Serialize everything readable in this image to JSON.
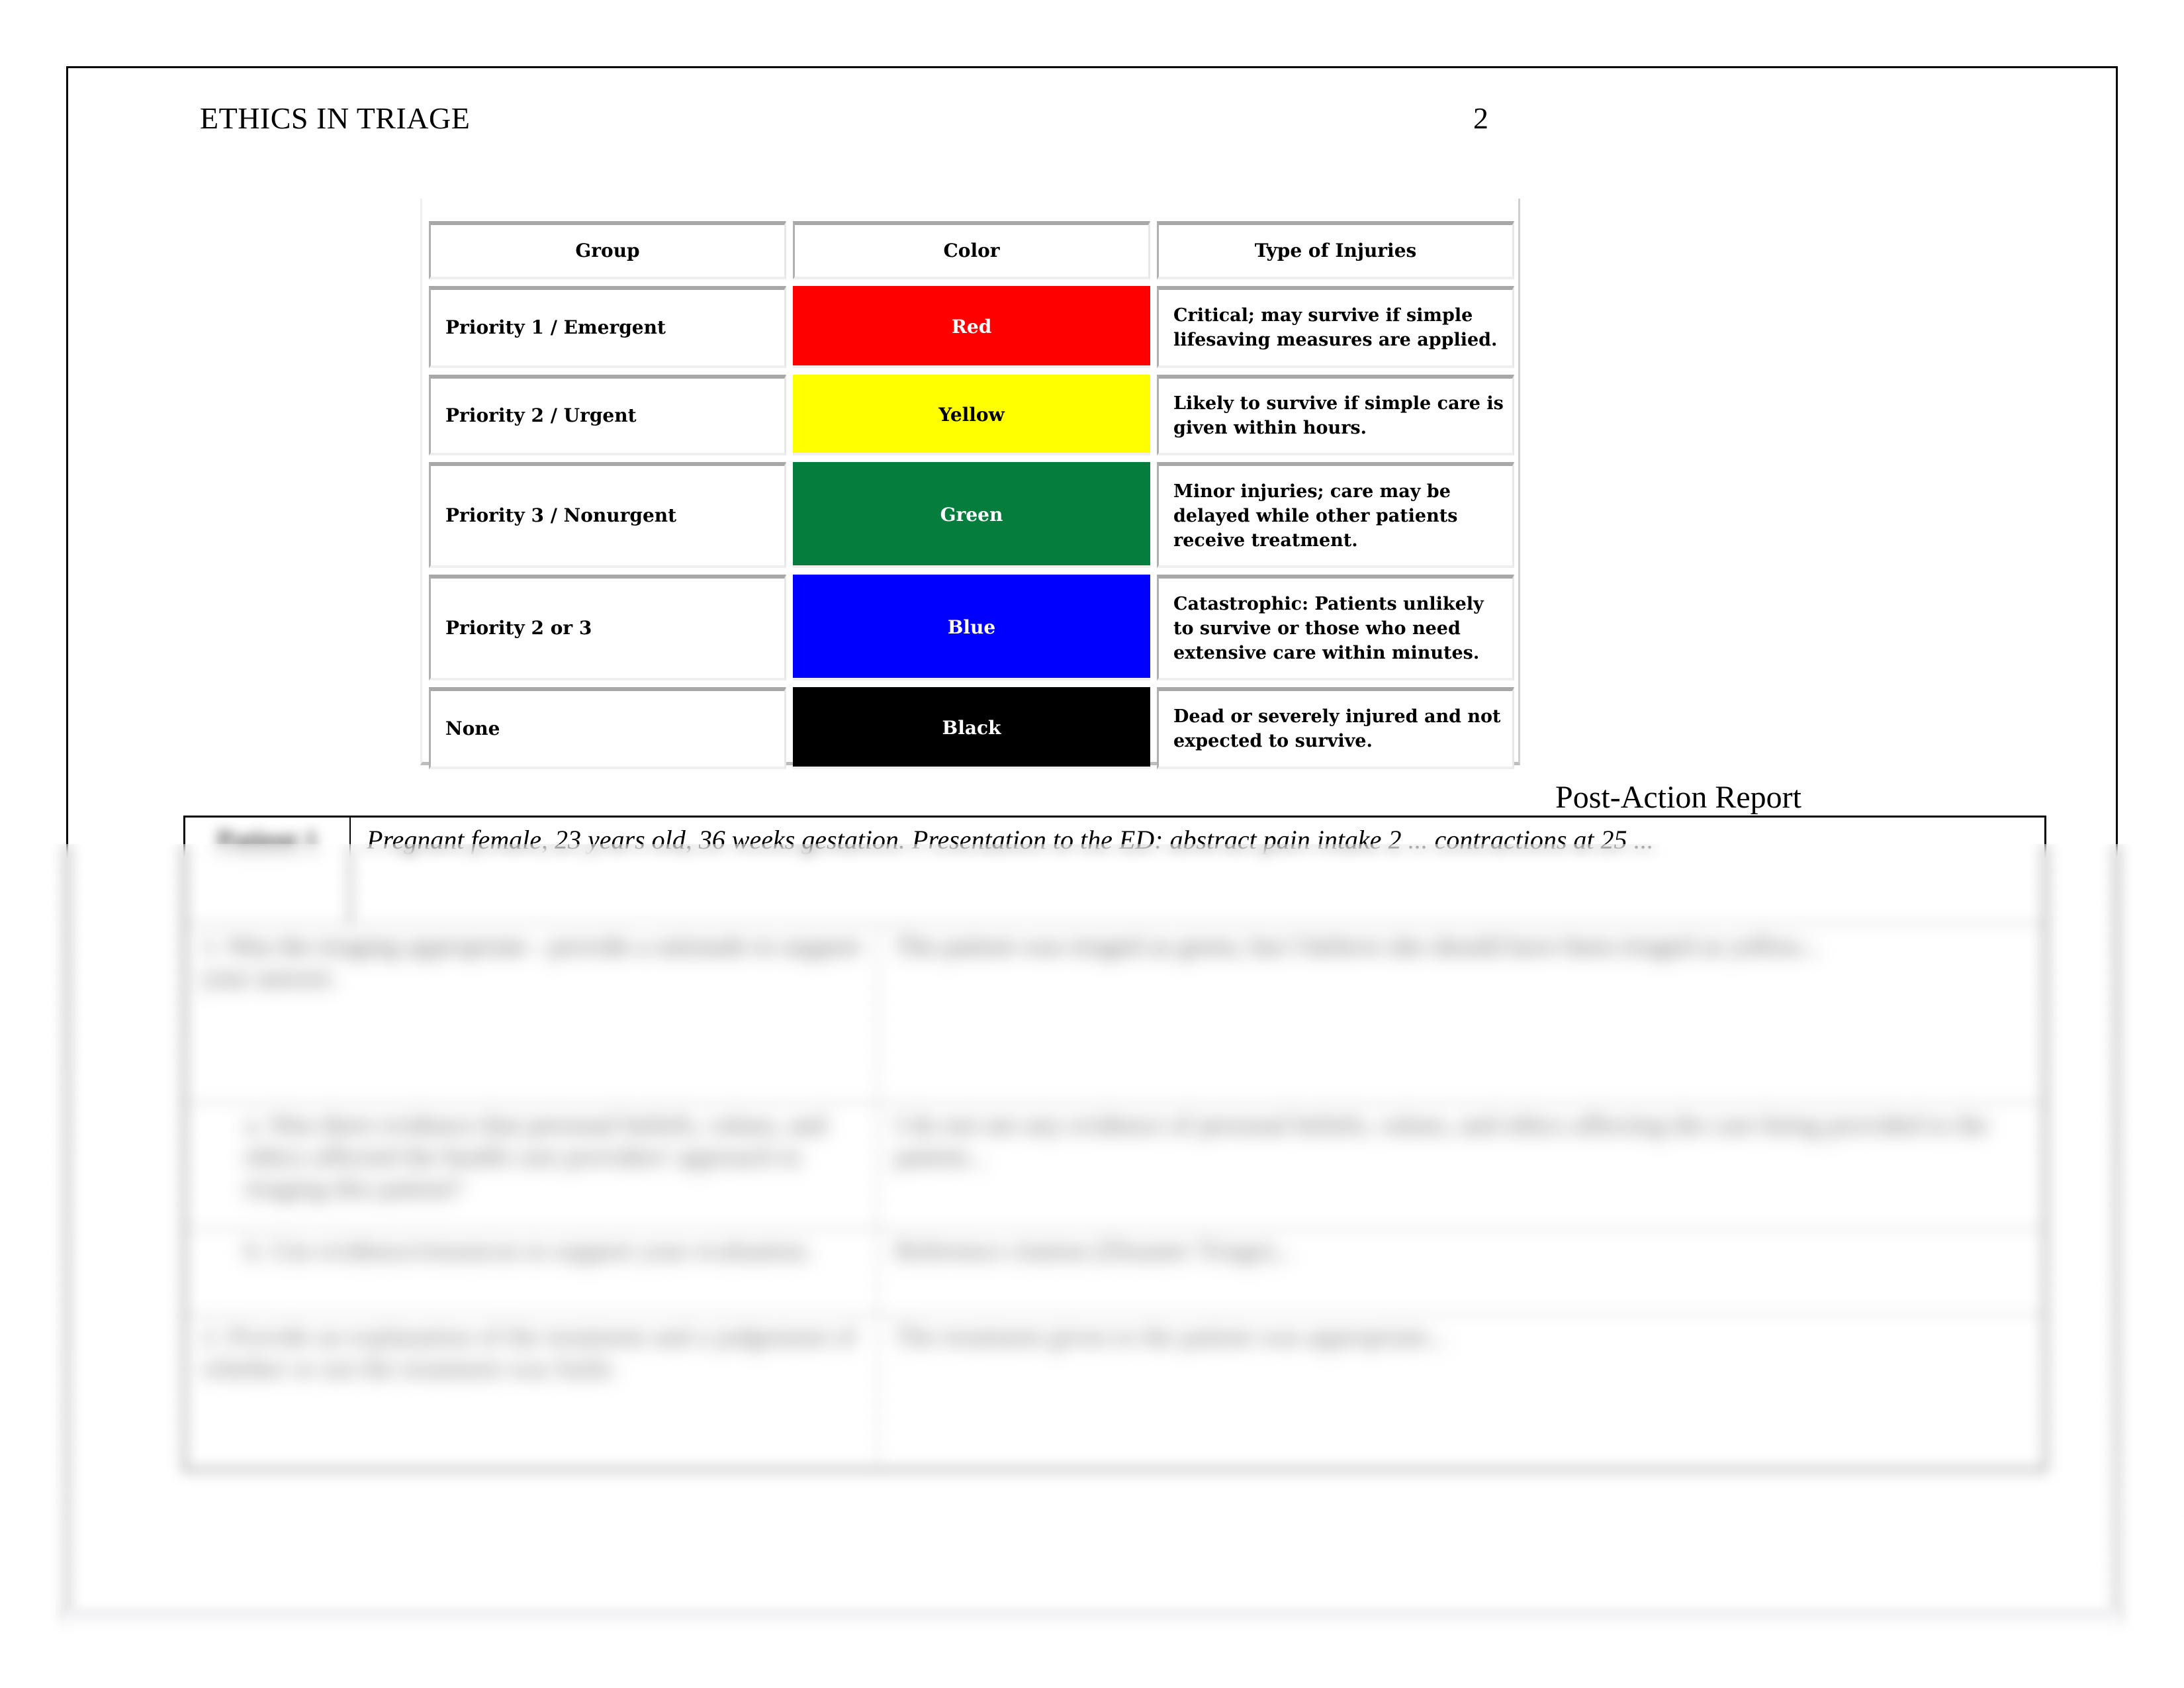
{
  "document": {
    "running_head": "ETHICS IN TRIAGE",
    "page_number": "2"
  },
  "triage_table": {
    "headers": [
      "Group",
      "Color",
      "Type of Injuries"
    ],
    "rows": [
      {
        "group": "Priority 1 / Emergent",
        "color_label": "Red",
        "color_hex": "#ff0000",
        "text_color": "#ffffff",
        "injuries": "Critical; may survive if simple lifesaving measures are applied."
      },
      {
        "group": "Priority 2 / Urgent",
        "color_label": "Yellow",
        "color_hex": "#ffff00",
        "text_color": "#000000",
        "injuries": "Likely to survive if simple care is given within hours."
      },
      {
        "group": "Priority 3 / Nonurgent",
        "color_label": "Green",
        "color_hex": "#057d3d",
        "text_color": "#ffffff",
        "injuries": "Minor injuries; care may be delayed while other patients receive treatment."
      },
      {
        "group": "Priority 2 or 3",
        "color_label": "Blue",
        "color_hex": "#0000ff",
        "text_color": "#ffffff",
        "injuries": "Catastrophic: Patients unlikely to survive or those who need extensive care within minutes."
      },
      {
        "group": "None",
        "color_label": "Black",
        "color_hex": "#000000",
        "text_color": "#ffffff",
        "injuries": "Dead or severely injured and not expected to survive."
      }
    ]
  },
  "report": {
    "title": "Post-Action Report",
    "patient_label": "Patient 1",
    "case_summary": "Pregnant female, 23 years old, 36 weeks gestation. Presentation to the ED: abstract pain intake 2 ... contractions at 25 ...",
    "questions": [
      {
        "label": "1. Was the triaging appropriate - provide a rationale to support your answer.",
        "answer": "The patient was triaged as green, but I believe she should have been triaged as yellow..."
      },
      {
        "label": "a. Was there evidence that personal beliefs, values, and ethics affected the health care providers' approach to triaging this patient?",
        "answer": "I do not see any evidence of personal beliefs, values, and ethics affecting the care being provided to the patient..."
      },
      {
        "label": "b. Use evidence/resources to support your evaluation.",
        "answer": "Reference citation (Disaster Triage)..."
      },
      {
        "label": "2. Provide an explanation of the treatment and a judgement of whether or not the treatment was futile.",
        "answer": "The treatment given to the patient was appropriate..."
      }
    ]
  }
}
